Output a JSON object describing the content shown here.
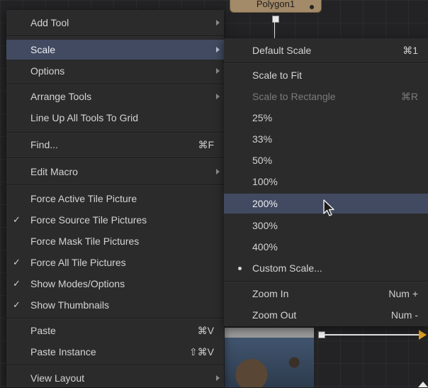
{
  "canvas": {
    "node_label": "Polygon1"
  },
  "main_menu": {
    "items": [
      {
        "label": "Add Tool",
        "has_submenu": true
      },
      {
        "label": "Scale",
        "has_submenu": true,
        "highlighted": true
      },
      {
        "label": "Options",
        "has_submenu": true
      },
      {
        "label": "Arrange Tools",
        "has_submenu": true
      },
      {
        "label": "Line Up All Tools To Grid"
      },
      {
        "label": "Find...",
        "shortcut": "⌘F"
      },
      {
        "label": "Edit Macro",
        "has_submenu": true
      },
      {
        "label": "Force Active Tile Picture",
        "checked": false
      },
      {
        "label": "Force Source Tile Pictures",
        "checked": true
      },
      {
        "label": "Force Mask Tile Pictures",
        "checked": false
      },
      {
        "label": "Force All Tile Pictures",
        "checked": true
      },
      {
        "label": "Show Modes/Options",
        "checked": true
      },
      {
        "label": "Show Thumbnails",
        "checked": true
      },
      {
        "label": "Paste",
        "shortcut": "⌘V"
      },
      {
        "label": "Paste Instance",
        "shortcut": "⇧⌘V"
      },
      {
        "label": "View Layout",
        "has_submenu": true
      }
    ],
    "check_glyph": "✓"
  },
  "scale_submenu": {
    "items": [
      {
        "label": "Default Scale",
        "shortcut": "⌘1"
      },
      {
        "label": "Scale to Fit"
      },
      {
        "label": "Scale to Rectangle",
        "shortcut": "⌘R",
        "disabled": true
      },
      {
        "label": "25%"
      },
      {
        "label": "33%"
      },
      {
        "label": "50%"
      },
      {
        "label": "100%"
      },
      {
        "label": "200%",
        "highlighted": true
      },
      {
        "label": "300%"
      },
      {
        "label": "400%"
      },
      {
        "label": "Custom Scale...",
        "selected_bullet": true
      },
      {
        "label": "Zoom In",
        "shortcut": "Num +"
      },
      {
        "label": "Zoom Out",
        "shortcut": "Num -"
      }
    ]
  },
  "colors": {
    "menu_bg": "#2b2b2c",
    "highlight": "#414a60",
    "node": "#a38a68",
    "link_arrow": "#e0a020"
  },
  "icons": [
    "submenu-arrow-icon",
    "checkmark-icon",
    "bullet-icon",
    "mouse-pointer-icon"
  ]
}
